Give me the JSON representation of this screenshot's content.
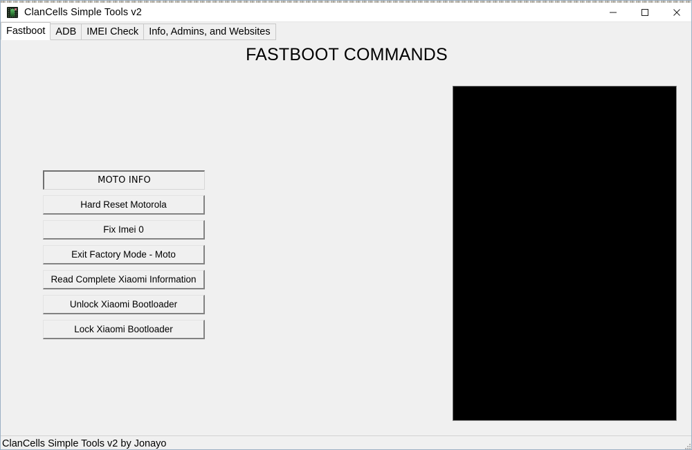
{
  "window": {
    "title": "ClanCells Simple Tools v2",
    "icon": "app-logo-icon",
    "controls": {
      "minimize": "minimize-icon",
      "maximize": "maximize-icon",
      "close": "close-icon"
    }
  },
  "tabs": [
    {
      "label": "Fastboot",
      "selected": true
    },
    {
      "label": "ADB",
      "selected": false
    },
    {
      "label": "IMEI Check",
      "selected": false
    },
    {
      "label": "Info, Admins, and Websites",
      "selected": false
    }
  ],
  "main": {
    "heading": "FASTBOOT COMMANDS",
    "buttons": [
      {
        "label": "MOTO INFO",
        "focused": true
      },
      {
        "label": "Hard Reset Motorola",
        "focused": false
      },
      {
        "label": "Fix Imei 0",
        "focused": false
      },
      {
        "label": "Exit Factory Mode - Moto",
        "focused": false
      },
      {
        "label": "Read Complete Xiaomi Information",
        "focused": false
      },
      {
        "label": "Unlock Xiaomi Bootloader",
        "focused": false
      },
      {
        "label": "Lock Xiaomi Bootloader",
        "focused": false
      }
    ],
    "console": {
      "text": "",
      "background": "#000000"
    }
  },
  "status": {
    "text": "ClanCells Simple Tools v2 by Jonayo"
  },
  "colors": {
    "window_background": "#f0f0f0",
    "title_bar": "#ffffff",
    "selected_tab": "#ffffff",
    "console_background": "#000000",
    "text": "#000000"
  }
}
